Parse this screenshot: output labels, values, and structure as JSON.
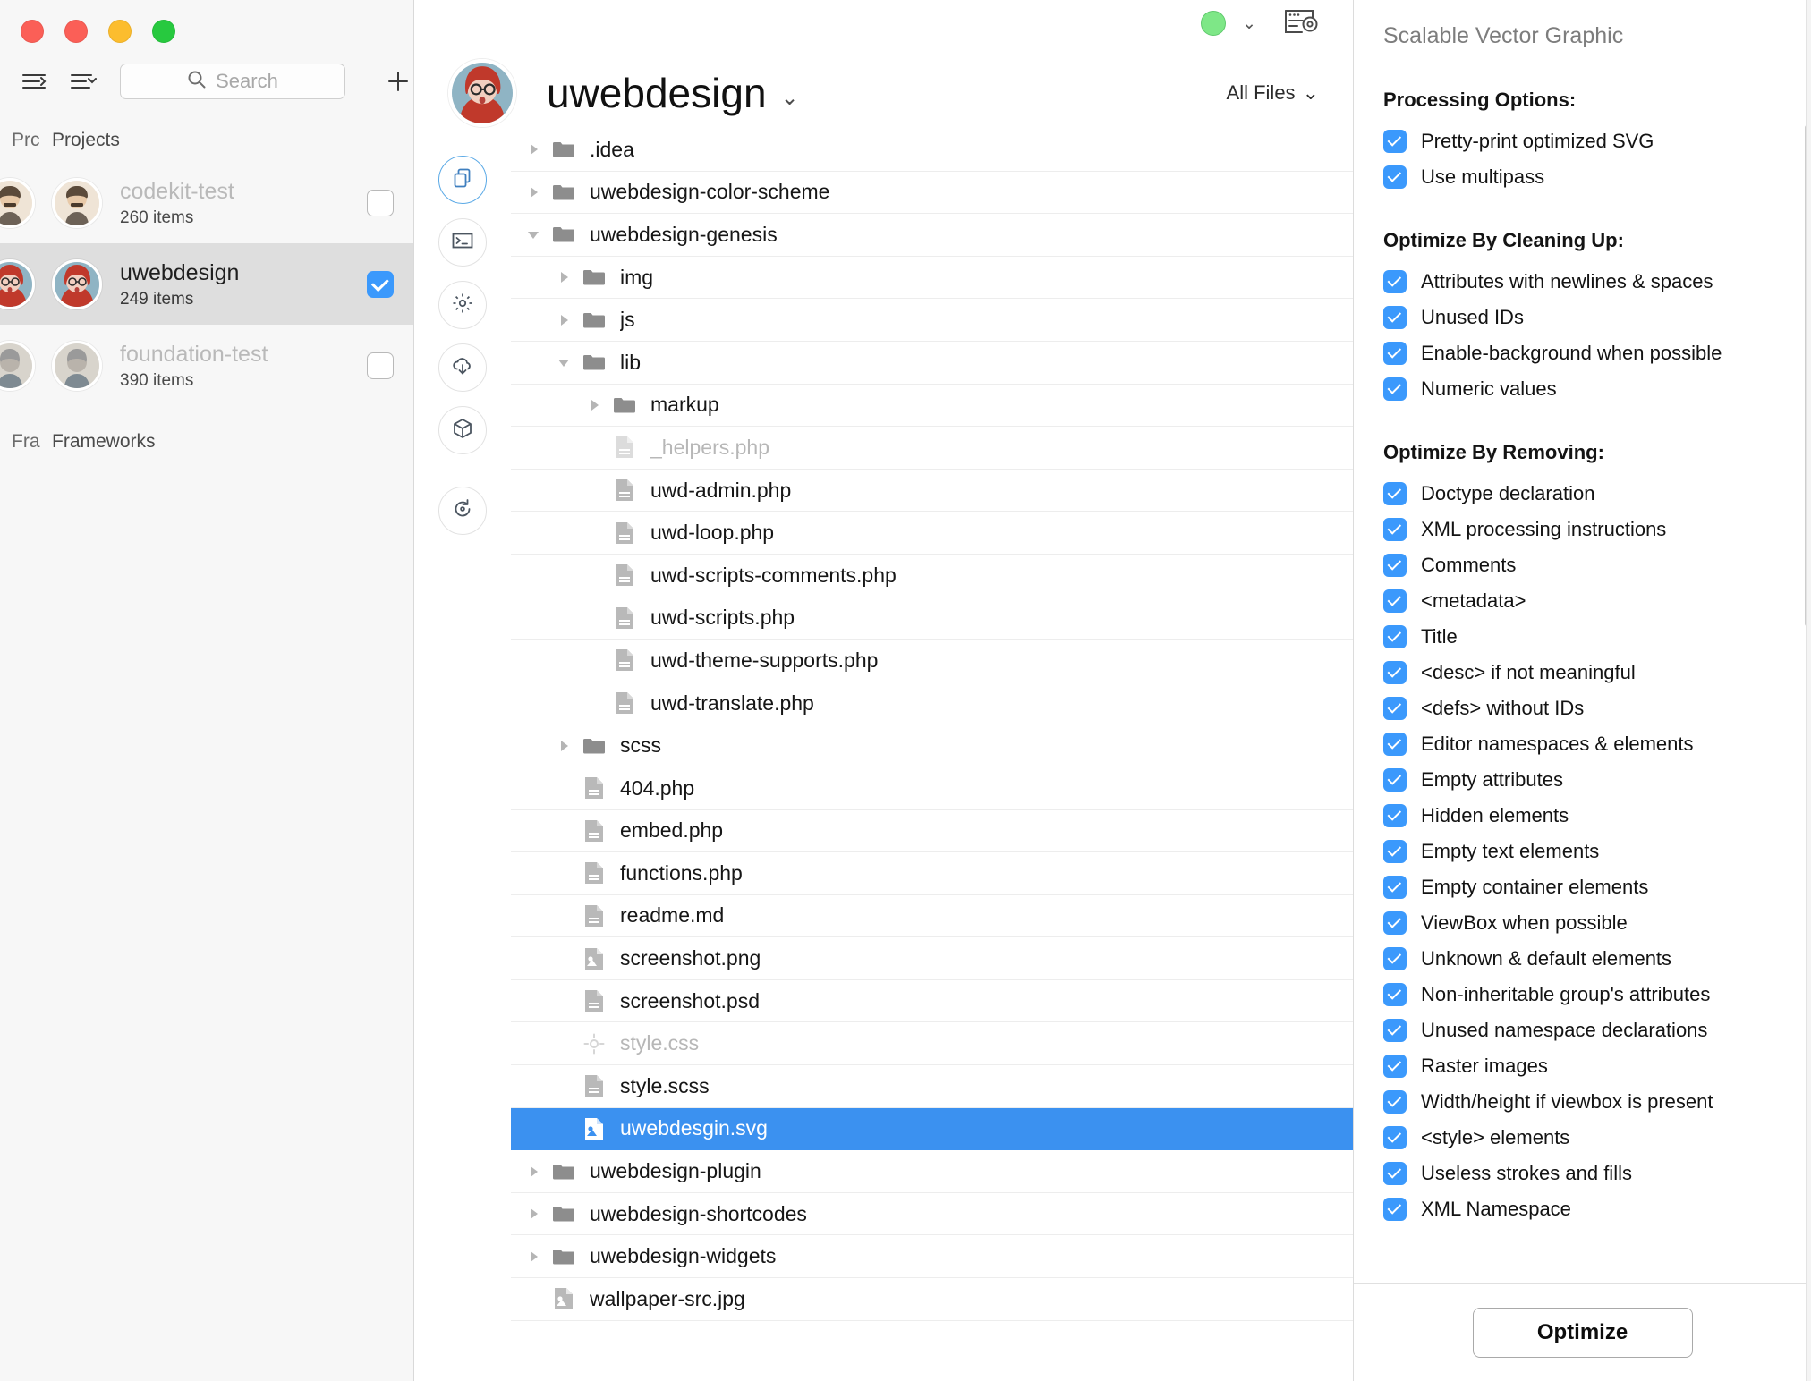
{
  "window": {
    "traffic_lights": [
      "close",
      "close-secondary",
      "minimize",
      "zoom"
    ]
  },
  "sidebar": {
    "toolbar": {
      "list_icon": "list-lines-icon",
      "sort_icon": "list-sort-icon",
      "add_icon": "plus-icon",
      "search_icon": "search-icon"
    },
    "search": {
      "placeholder": "Search",
      "value": ""
    },
    "sections": [
      {
        "label": "Projects",
        "ghost": "Prc"
      },
      {
        "label": "Frameworks",
        "ghost": "Fra"
      }
    ],
    "projects": [
      {
        "name": "codekit-test",
        "count": "260 items",
        "checked": false,
        "selected": false,
        "dim": true
      },
      {
        "name": "uwebdesign",
        "count": "249 items",
        "checked": true,
        "selected": true,
        "dim": false
      },
      {
        "name": "foundation-test",
        "count": "390 items",
        "checked": false,
        "selected": false,
        "dim": true
      }
    ]
  },
  "main": {
    "status": {
      "dot_color": "#7ee787",
      "caret": "⌄"
    },
    "preview_icon": "browser-preview-icon",
    "title": "uwebdesign",
    "title_caret": "⌄",
    "filter": {
      "label": "All Files",
      "caret": "⌄"
    },
    "rail": [
      {
        "icon": "files-icon",
        "active": true
      },
      {
        "icon": "terminal-icon",
        "active": false
      },
      {
        "icon": "gear-icon",
        "active": false
      },
      {
        "icon": "cloud-download-icon",
        "active": false
      },
      {
        "icon": "package-cube-icon",
        "active": false
      },
      {
        "icon": "history-refresh-icon",
        "active": false
      }
    ],
    "files": [
      {
        "name": ".idea",
        "type": "folder",
        "indent": 0,
        "twisty": "right",
        "dim": false,
        "selected": false
      },
      {
        "name": "uwebdesign-color-scheme",
        "type": "folder",
        "indent": 0,
        "twisty": "right",
        "dim": false,
        "selected": false
      },
      {
        "name": "uwebdesign-genesis",
        "type": "folder",
        "indent": 0,
        "twisty": "down",
        "dim": false,
        "selected": false
      },
      {
        "name": "img",
        "type": "folder",
        "indent": 1,
        "twisty": "right",
        "dim": false,
        "selected": false
      },
      {
        "name": "js",
        "type": "folder",
        "indent": 1,
        "twisty": "right",
        "dim": false,
        "selected": false
      },
      {
        "name": "lib",
        "type": "folder",
        "indent": 1,
        "twisty": "down",
        "dim": false,
        "selected": false
      },
      {
        "name": "markup",
        "type": "folder",
        "indent": 2,
        "twisty": "right",
        "dim": false,
        "selected": false
      },
      {
        "name": "_helpers.php",
        "type": "file",
        "indent": 2,
        "twisty": "none",
        "dim": true,
        "selected": false
      },
      {
        "name": "uwd-admin.php",
        "type": "file",
        "indent": 2,
        "twisty": "none",
        "dim": false,
        "selected": false
      },
      {
        "name": "uwd-loop.php",
        "type": "file",
        "indent": 2,
        "twisty": "none",
        "dim": false,
        "selected": false
      },
      {
        "name": "uwd-scripts-comments.php",
        "type": "file",
        "indent": 2,
        "twisty": "none",
        "dim": false,
        "selected": false
      },
      {
        "name": "uwd-scripts.php",
        "type": "file",
        "indent": 2,
        "twisty": "none",
        "dim": false,
        "selected": false
      },
      {
        "name": "uwd-theme-supports.php",
        "type": "file",
        "indent": 2,
        "twisty": "none",
        "dim": false,
        "selected": false
      },
      {
        "name": "uwd-translate.php",
        "type": "file",
        "indent": 2,
        "twisty": "none",
        "dim": false,
        "selected": false
      },
      {
        "name": "scss",
        "type": "folder",
        "indent": 1,
        "twisty": "right",
        "dim": false,
        "selected": false
      },
      {
        "name": "404.php",
        "type": "file",
        "indent": 1,
        "twisty": "none",
        "dim": false,
        "selected": false
      },
      {
        "name": "embed.php",
        "type": "file",
        "indent": 1,
        "twisty": "none",
        "dim": false,
        "selected": false
      },
      {
        "name": "functions.php",
        "type": "file",
        "indent": 1,
        "twisty": "none",
        "dim": false,
        "selected": false
      },
      {
        "name": "readme.md",
        "type": "file",
        "indent": 1,
        "twisty": "none",
        "dim": false,
        "selected": false
      },
      {
        "name": "screenshot.png",
        "type": "image",
        "indent": 1,
        "twisty": "none",
        "dim": false,
        "selected": false
      },
      {
        "name": "screenshot.psd",
        "type": "file",
        "indent": 1,
        "twisty": "none",
        "dim": false,
        "selected": false
      },
      {
        "name": "style.css",
        "type": "target",
        "indent": 1,
        "twisty": "none",
        "dim": true,
        "selected": false
      },
      {
        "name": "style.scss",
        "type": "file",
        "indent": 1,
        "twisty": "none",
        "dim": false,
        "selected": false
      },
      {
        "name": "uwebdesgin.svg",
        "type": "image",
        "indent": 1,
        "twisty": "none",
        "dim": false,
        "selected": true
      },
      {
        "name": "uwebdesign-plugin",
        "type": "folder",
        "indent": 0,
        "twisty": "right",
        "dim": false,
        "selected": false
      },
      {
        "name": "uwebdesign-shortcodes",
        "type": "folder",
        "indent": 0,
        "twisty": "right",
        "dim": false,
        "selected": false
      },
      {
        "name": "uwebdesign-widgets",
        "type": "folder",
        "indent": 0,
        "twisty": "right",
        "dim": false,
        "selected": false
      },
      {
        "name": "wallpaper-src.jpg",
        "type": "image",
        "indent": 0,
        "twisty": "none",
        "dim": false,
        "selected": false
      }
    ]
  },
  "inspector": {
    "title": "Scalable Vector Graphic",
    "groups": [
      {
        "title": "Processing Options:",
        "items": [
          {
            "label": "Pretty-print optimized SVG",
            "checked": true
          },
          {
            "label": "Use multipass",
            "checked": true
          }
        ]
      },
      {
        "title": "Optimize By Cleaning Up:",
        "items": [
          {
            "label": "Attributes with newlines & spaces",
            "checked": true
          },
          {
            "label": "Unused IDs",
            "checked": true
          },
          {
            "label": "Enable-background when possible",
            "checked": true
          },
          {
            "label": "Numeric values",
            "checked": true
          }
        ]
      },
      {
        "title": "Optimize By Removing:",
        "items": [
          {
            "label": "Doctype declaration",
            "checked": true
          },
          {
            "label": "XML processing instructions",
            "checked": true
          },
          {
            "label": "Comments",
            "checked": true
          },
          {
            "label": "<metadata>",
            "checked": true
          },
          {
            "label": "Title",
            "checked": true
          },
          {
            "label": "<desc> if not meaningful",
            "checked": true
          },
          {
            "label": "<defs> without IDs",
            "checked": true
          },
          {
            "label": "Editor namespaces & elements",
            "checked": true
          },
          {
            "label": "Empty attributes",
            "checked": true
          },
          {
            "label": "Hidden elements",
            "checked": true
          },
          {
            "label": "Empty text elements",
            "checked": true
          },
          {
            "label": "Empty container elements",
            "checked": true
          },
          {
            "label": "ViewBox when possible",
            "checked": true
          },
          {
            "label": "Unknown & default elements",
            "checked": true
          },
          {
            "label": "Non-inheritable group's attributes",
            "checked": true
          },
          {
            "label": "Unused namespace declarations",
            "checked": true
          },
          {
            "label": "Raster images",
            "checked": true
          },
          {
            "label": "Width/height if viewbox is present",
            "checked": true
          },
          {
            "label": "<style> elements",
            "checked": true
          },
          {
            "label": "Useless strokes and fills",
            "checked": true
          },
          {
            "label": "XML Namespace",
            "checked": true
          }
        ]
      }
    ],
    "optimize_button": "Optimize"
  },
  "colors": {
    "accent": "#3b99fc",
    "selection": "#3b91f0",
    "sidebar_selection": "#dedede",
    "status_green": "#7ee787"
  }
}
